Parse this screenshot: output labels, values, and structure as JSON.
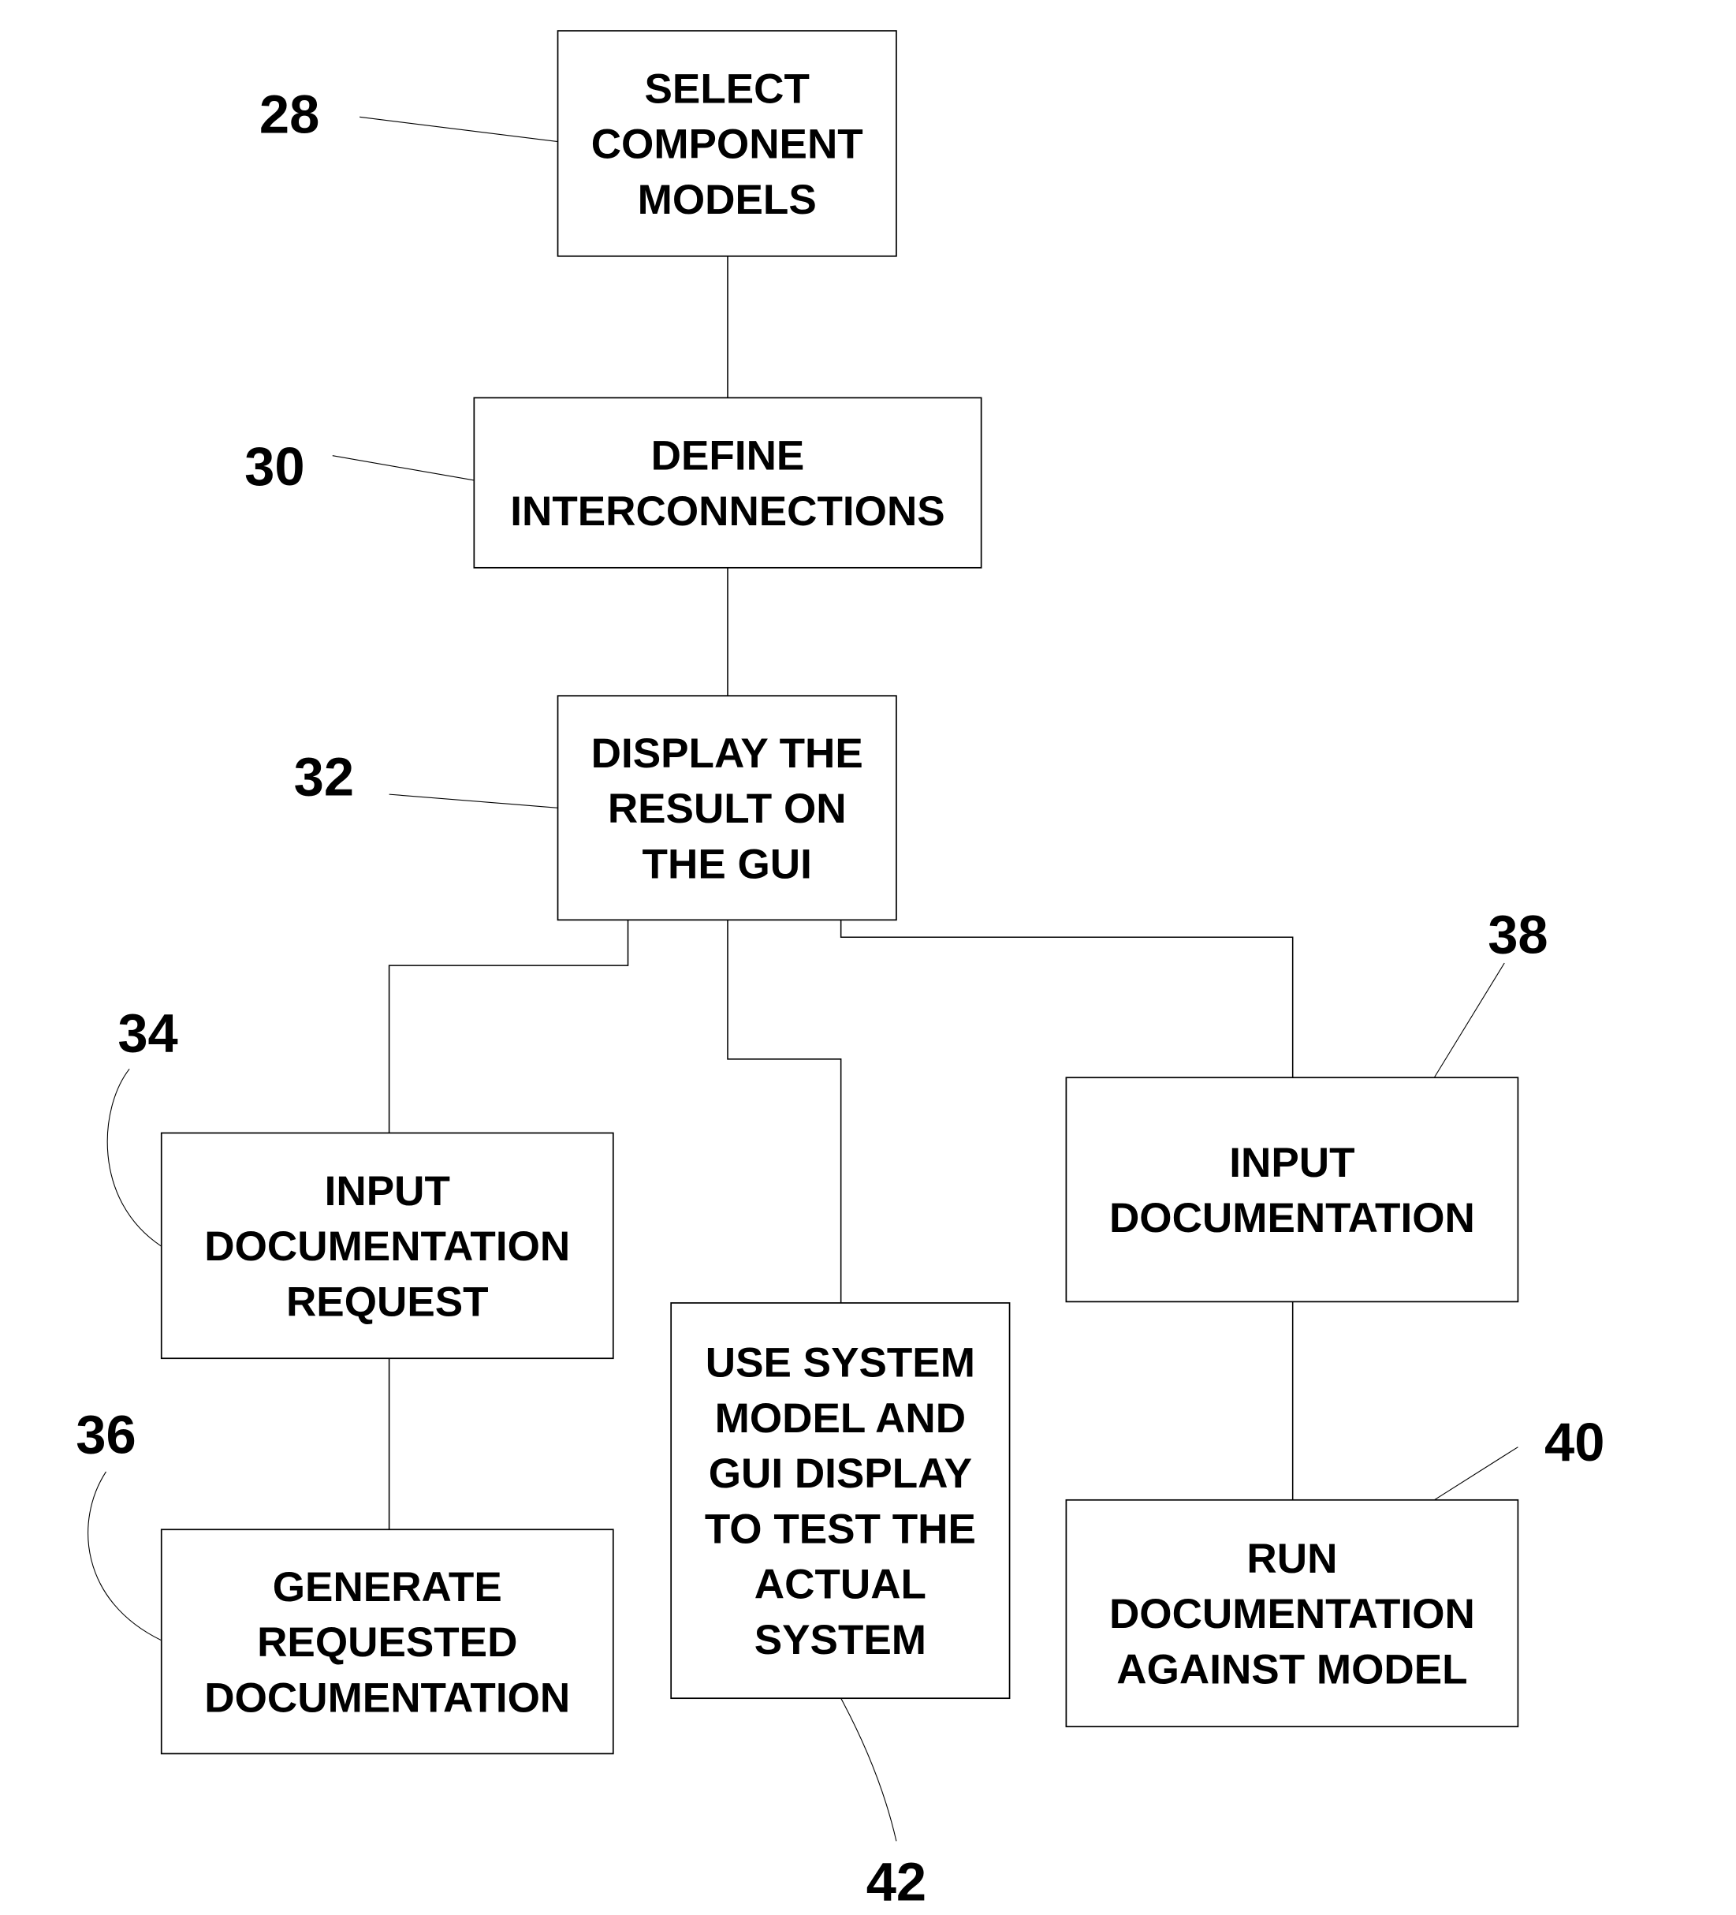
{
  "diagram": {
    "type": "flowchart",
    "background": "#ffffff",
    "line_color": "#000000",
    "steps": [
      {
        "ref": "28",
        "lines": [
          "SELECT",
          "COMPONENT",
          "MODELS"
        ]
      },
      {
        "ref": "30",
        "lines": [
          "DEFINE",
          "INTERCONNECTIONS"
        ]
      },
      {
        "ref": "32",
        "lines": [
          "DISPLAY THE",
          "RESULT ON",
          "THE GUI"
        ]
      },
      {
        "ref": "34",
        "lines": [
          "INPUT",
          "DOCUMENTATION",
          "REQUEST"
        ]
      },
      {
        "ref": "36",
        "lines": [
          "GENERATE",
          "REQUESTED",
          "DOCUMENTATION"
        ]
      },
      {
        "ref": "42",
        "lines": [
          "USE SYSTEM",
          "MODEL AND",
          "GUI DISPLAY",
          "TO TEST THE",
          "ACTUAL",
          "SYSTEM"
        ]
      },
      {
        "ref": "38",
        "lines": [
          "INPUT",
          "DOCUMENTATION"
        ]
      },
      {
        "ref": "40",
        "lines": [
          "RUN",
          "DOCUMENTATION",
          "AGAINST MODEL"
        ]
      }
    ],
    "connections": [
      [
        "28",
        "30"
      ],
      [
        "30",
        "32"
      ],
      [
        "32",
        "34"
      ],
      [
        "32",
        "42"
      ],
      [
        "32",
        "38"
      ],
      [
        "34",
        "36"
      ],
      [
        "38",
        "40"
      ]
    ]
  }
}
